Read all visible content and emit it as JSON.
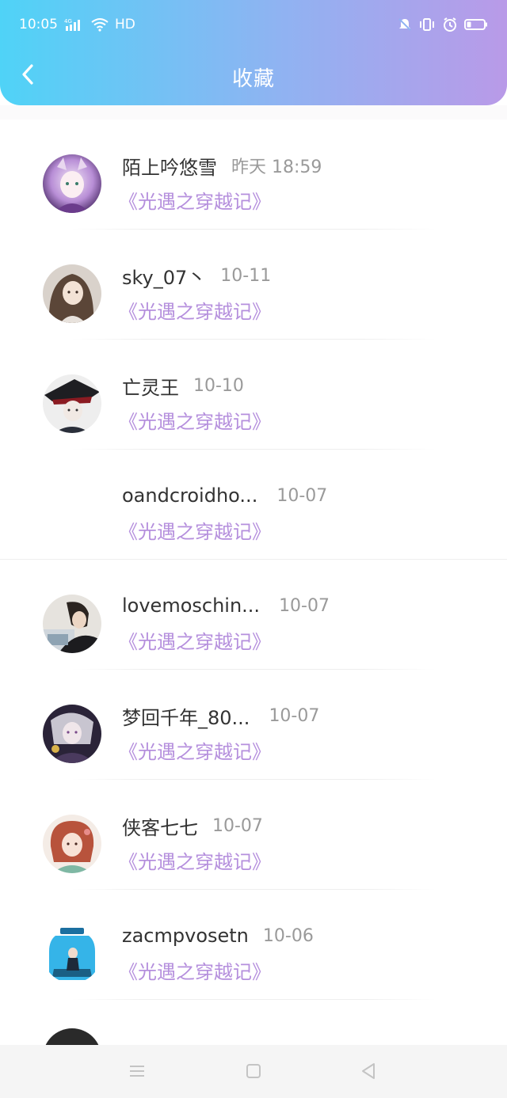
{
  "status_bar": {
    "time": "10:05",
    "network": "4G",
    "wifi_label": "HD",
    "icons_left": [
      "signal-icon",
      "wifi-icon"
    ],
    "icons_right": [
      "mute-icon",
      "vibrate-icon",
      "alarm-icon",
      "battery-icon"
    ]
  },
  "header": {
    "title": "收藏",
    "back_icon": "chevron-left-icon"
  },
  "colors": {
    "header_gradient_start": "#4fd3f7",
    "header_gradient_end": "#b99ae8",
    "book_title": "#b58fdd",
    "name": "#333333",
    "time": "#9a9a9a"
  },
  "items": [
    {
      "name": "陌上吟悠雪",
      "time": "昨天 18:59",
      "book": "《光遇之穿越记》",
      "has_avatar": true
    },
    {
      "name": "sky_07丶",
      "time": "10-11",
      "book": "《光遇之穿越记》",
      "has_avatar": true
    },
    {
      "name": "亡灵王",
      "time": "10-10",
      "book": "《光遇之穿越记》",
      "has_avatar": true
    },
    {
      "name": "oandcroidho...",
      "time": "10-07",
      "book": "《光遇之穿越记》",
      "has_avatar": false
    },
    {
      "name": "lovemoschin...",
      "time": "10-07",
      "book": "《光遇之穿越记》",
      "has_avatar": true
    },
    {
      "name": "梦回千年_80...",
      "time": "10-07",
      "book": "《光遇之穿越记》",
      "has_avatar": true
    },
    {
      "name": "侠客七七",
      "time": "10-07",
      "book": "《光遇之穿越记》",
      "has_avatar": true
    },
    {
      "name": "zacmpvosetn",
      "time": "10-06",
      "book": "《光遇之穿越记》",
      "has_avatar": true
    }
  ],
  "bottom_nav": [
    "menu-icon",
    "home-icon",
    "back-icon"
  ]
}
